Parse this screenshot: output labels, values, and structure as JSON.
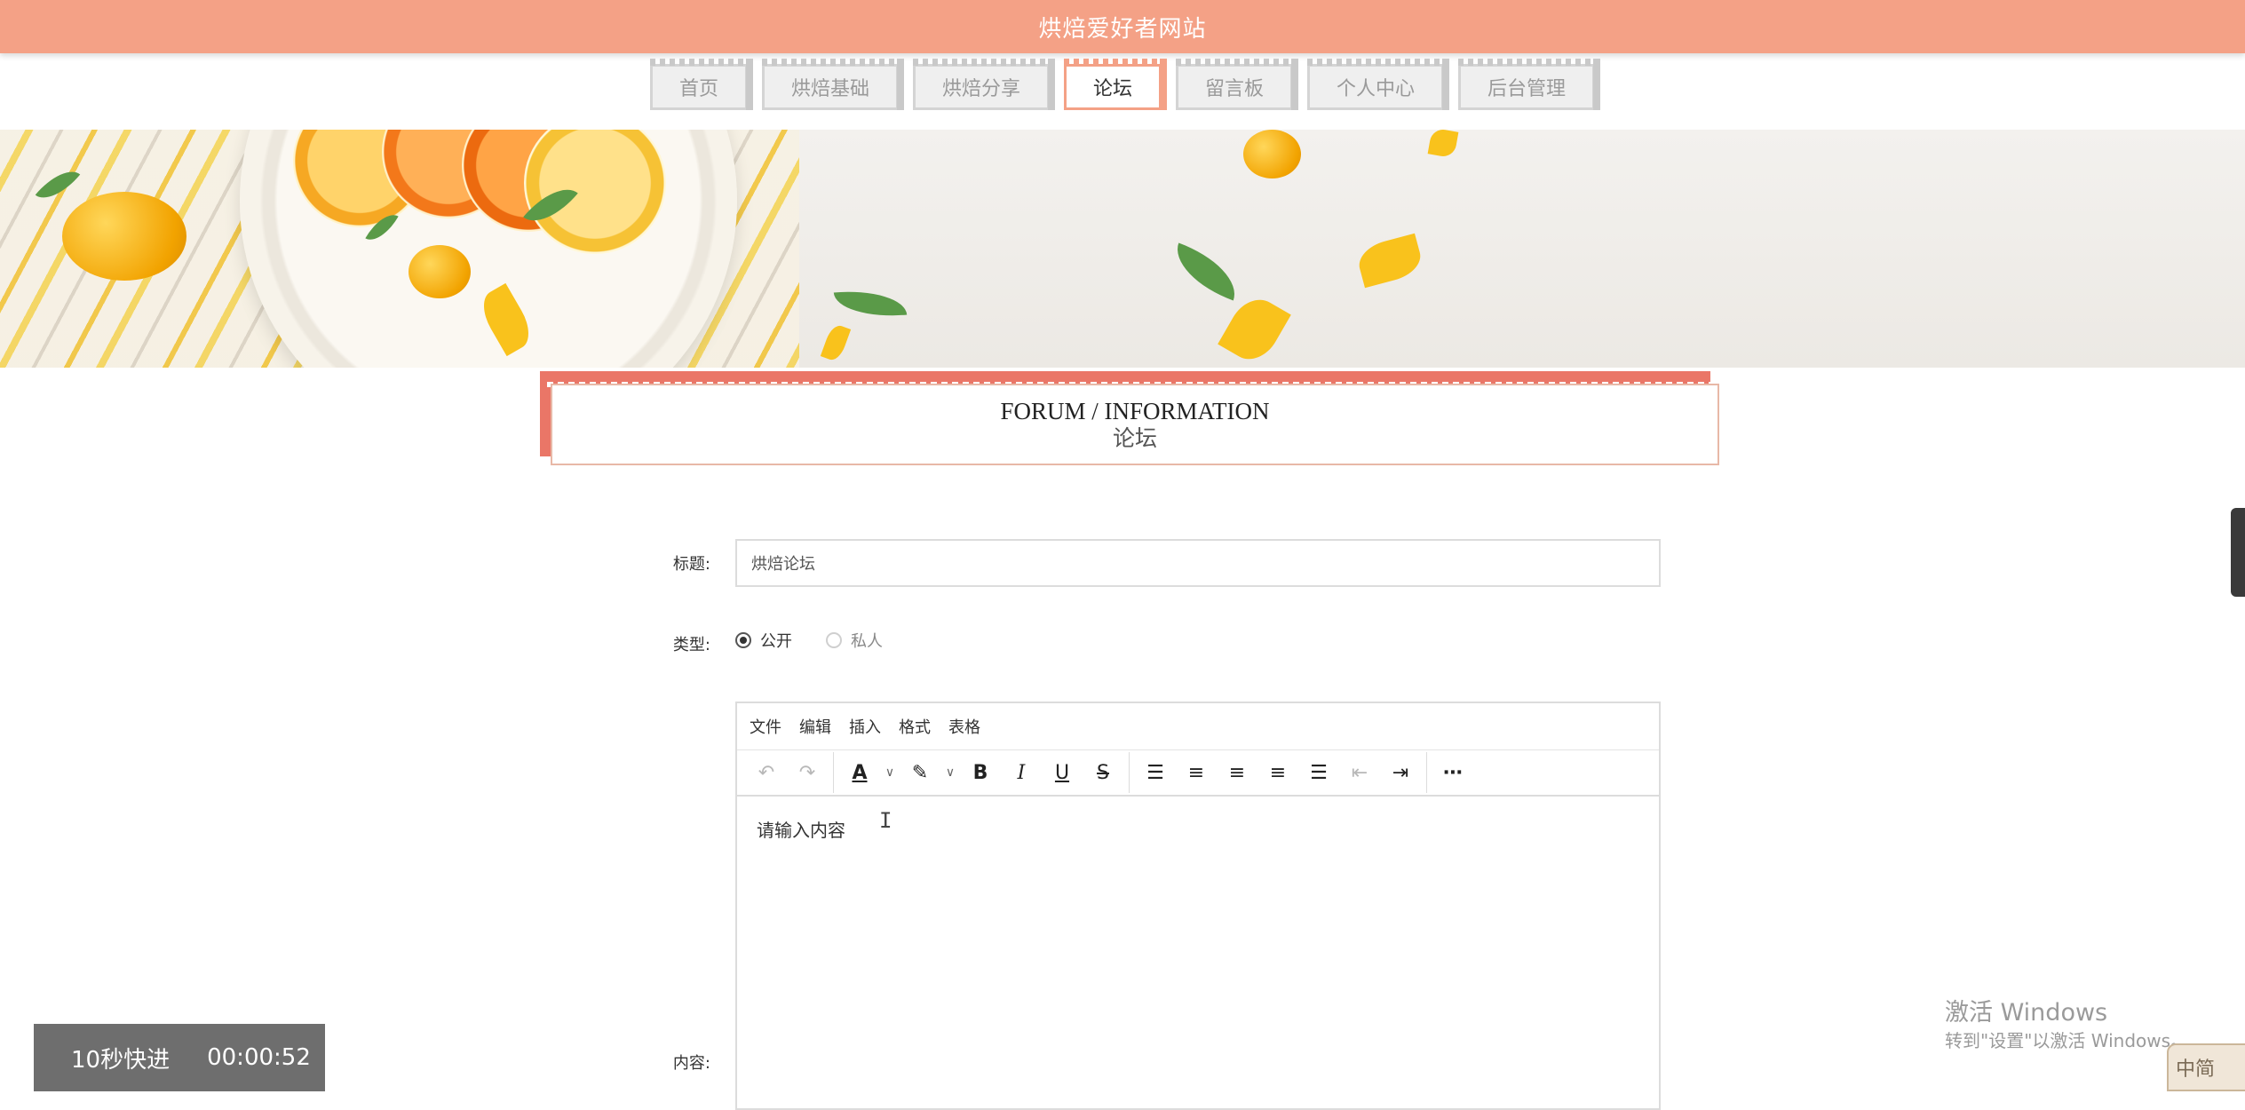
{
  "header": {
    "site_title": "烘焙爱好者网站"
  },
  "nav": {
    "items": [
      {
        "label": "首页"
      },
      {
        "label": "烘焙基础"
      },
      {
        "label": "烘焙分享"
      },
      {
        "label": "论坛",
        "active": true
      },
      {
        "label": "留言板"
      },
      {
        "label": "个人中心"
      },
      {
        "label": "后台管理"
      }
    ]
  },
  "section": {
    "title_en": "FORUM / INFORMATION",
    "title_cn": "论坛"
  },
  "form": {
    "title_label": "标题:",
    "title_value": "烘焙论坛",
    "type_label": "类型:",
    "type_options": [
      {
        "label": "公开",
        "selected": true
      },
      {
        "label": "私人",
        "selected": false
      }
    ],
    "content_label": "内容:"
  },
  "editor": {
    "menu": [
      "文件",
      "编辑",
      "插入",
      "格式",
      "表格"
    ],
    "toolbar_icons": [
      "undo-icon",
      "redo-icon",
      "font-color-icon",
      "highlight-icon",
      "bold-icon",
      "italic-icon",
      "underline-icon",
      "strikethrough-icon",
      "line-height-icon",
      "align-left-icon",
      "align-center-icon",
      "align-right-icon",
      "align-justify-icon",
      "outdent-icon",
      "indent-icon",
      "more-icon"
    ],
    "placeholder": "请输入内容"
  },
  "player": {
    "skip_label": "10秒快进",
    "time": "00:00:52"
  },
  "watermark": {
    "line1": "激活 Windows",
    "line2": "转到\"设置\"以激活 Windows。"
  },
  "ime": {
    "label": "中简"
  },
  "colors": {
    "header_bg": "#f4a186",
    "accent_red": "#ea7667"
  }
}
